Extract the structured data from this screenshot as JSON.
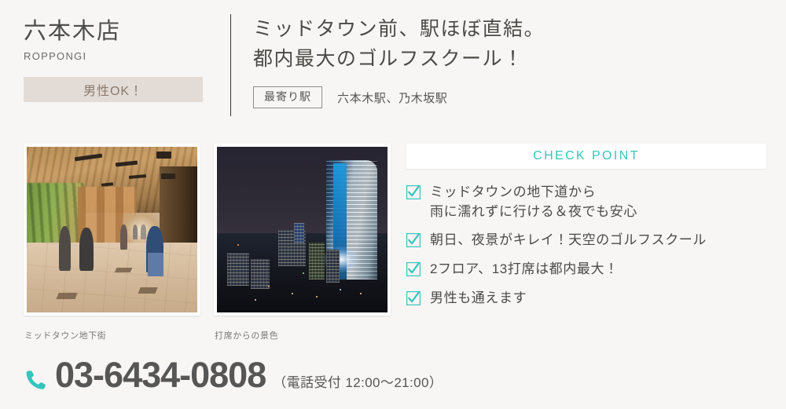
{
  "store": {
    "name_ja": "六本木店",
    "name_en": "ROPPONGI",
    "badge_label": "男性OK！"
  },
  "headline": {
    "line1": "ミッドタウン前、駅ほぼ直結。",
    "line2": "都内最大のゴルフスクール！"
  },
  "station": {
    "box_label": "最寄り駅",
    "names": "六本木駅、乃木坂駅"
  },
  "photos": [
    {
      "caption": "ミッドタウン地下街",
      "alt": "ミッドタウン地下街の通路"
    },
    {
      "caption": "打席からの景色",
      "alt": "打席から見た夜景"
    }
  ],
  "checkpoint": {
    "title": "CHECK POINT",
    "items": [
      "ミッドタウンの地下道から\n雨に濡れずに行ける＆夜でも安心",
      "朝日、夜景がキレイ！天空のゴルフスクール",
      "2フロア、13打席は都内最大！",
      "男性も通えます"
    ]
  },
  "contact": {
    "phone": "03-6434-0808",
    "hours": "（電話受付 12:00〜21:00）"
  },
  "icons": {
    "phone": "phone-icon",
    "check": "check-icon"
  },
  "colors": {
    "background": "#f7f6f4",
    "accent_teal": "#35c5bd",
    "badge_bg": "#e3dcd6",
    "badge_text": "#8a7a6e",
    "text": "#4a4a4a"
  }
}
